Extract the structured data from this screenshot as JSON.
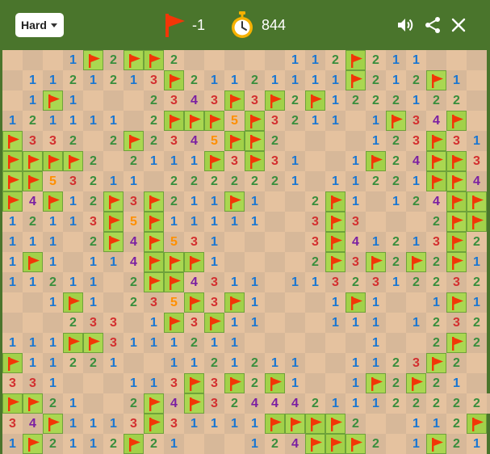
{
  "header": {
    "difficulty": "Hard",
    "flags_remaining": "-1",
    "timer": "844",
    "icons": [
      "flag-icon",
      "stopwatch-icon",
      "sound-icon",
      "share-icon",
      "close-icon"
    ]
  },
  "colors": {
    "header_bg": "#4a752c",
    "hidden_light": "#aad751",
    "hidden_dark": "#a2d149",
    "open_light": "#e5c29f",
    "open_dark": "#d7b899",
    "flag": "#f23607",
    "n1": "#1976d2",
    "n2": "#388e3c",
    "n3": "#d32f2f",
    "n4": "#7b1fa2",
    "n5": "#ff8f00"
  },
  "board": {
    "cols": 24,
    "rows": 20,
    "legend": "'.' = revealed empty, 'F' = flagged, digits = revealed number",
    "grid": [
      "...1F2FF2.....112F211...",
      ".1121213F21121111F212F1.",
      ".1F1...2343F3F2F1222122.",
      "121111.2FFF5F3211.1F34F.",
      "F332.2F2345FF2....123F31",
      "FFFF2.2111F3F31..1F24FF3",
      "FF53211.2222221.11221FF4",
      "F4F12F3F211F1..2F1.124FF",
      "12113F5F11111..3F3...2FF",
      "111.2F4F531....3F41213F2",
      "1F1.114FFF1....2F3F2F2F1",
      "11211.2FF4311.1132312232",
      "..1F1.235F3F1...1F1..1F1",
      "...233.1F3F11...111.1232",
      "111FF3111211......1..2F2",
      "F11221..1121211..1123F2.",
      "331...113F3F2F1..1F2F21.",
      "FF21..2F4F324442111222221",
      "34F1113F31111FFFF2..112F",
      "1F2112F21...124FFF2.1F21"
    ]
  }
}
